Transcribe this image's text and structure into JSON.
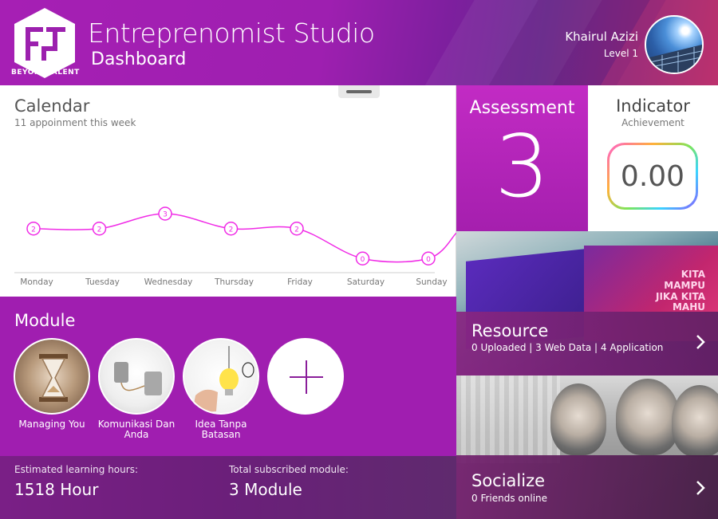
{
  "header": {
    "brand": "BEYONDTALENT",
    "title": "Entreprenomist Studio",
    "subtitle": "Dashboard",
    "user_name": "Khairul Azizi",
    "user_level": "Level 1"
  },
  "calendar": {
    "title": "Calendar",
    "subtitle": "11 appoinment this week"
  },
  "chart_data": {
    "type": "line",
    "categories": [
      "Monday",
      "Tuesday",
      "Wednesday",
      "Thursday",
      "Friday",
      "Saturday",
      "Sunday"
    ],
    "values": [
      2,
      2,
      3,
      2,
      2,
      0,
      0
    ],
    "title": "",
    "xlabel": "",
    "ylabel": "",
    "ylim": [
      -1,
      7
    ],
    "grid": false,
    "color": "#f02ae6"
  },
  "assessment": {
    "title": "Assessment",
    "value": "3"
  },
  "indicator": {
    "title": "Indicator",
    "subtitle": "Achievement",
    "value": "0.00"
  },
  "resource": {
    "title": "Resource",
    "subtitle": "0 Uploaded | 3 Web Data | 4 Application",
    "brochure_text": [
      "KITA",
      "MAMPU",
      "JIKA KITA",
      "MAHU"
    ]
  },
  "socialize": {
    "title": "Socialize",
    "subtitle": "0 Friends online"
  },
  "module": {
    "title": "Module",
    "items": [
      {
        "label": "Managing You"
      },
      {
        "label": "Komunikasi Dan Anda"
      },
      {
        "label": "Idea Tanpa Batasan"
      }
    ]
  },
  "stats": {
    "hours_label": "Estimated learning hours:",
    "hours_value": "1518 Hour",
    "modules_label": "Total subscribed module:",
    "modules_value": "3 Module"
  },
  "colors": {
    "brand_purple": "#a01eb0",
    "assessment": "#b826bc",
    "chart_line": "#f02ae6"
  }
}
